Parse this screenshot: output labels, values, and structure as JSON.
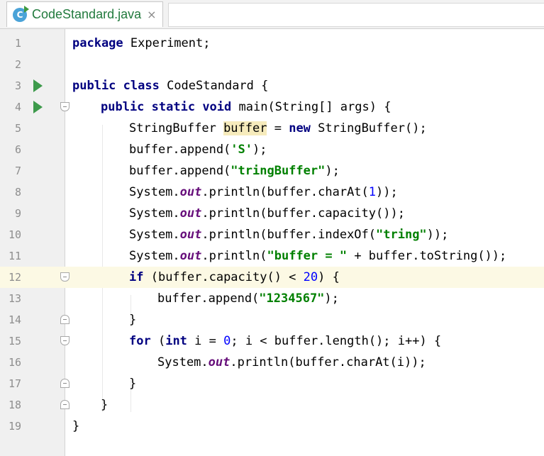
{
  "tab": {
    "title": "CodeStandard.java",
    "close": "×",
    "icon_letter": "C"
  },
  "lines": [
    {
      "n": "1"
    },
    {
      "n": "2"
    },
    {
      "n": "3"
    },
    {
      "n": "4"
    },
    {
      "n": "5"
    },
    {
      "n": "6"
    },
    {
      "n": "7"
    },
    {
      "n": "8"
    },
    {
      "n": "9"
    },
    {
      "n": "10"
    },
    {
      "n": "11"
    },
    {
      "n": "12"
    },
    {
      "n": "13"
    },
    {
      "n": "14"
    },
    {
      "n": "15"
    },
    {
      "n": "16"
    },
    {
      "n": "17"
    },
    {
      "n": "18"
    },
    {
      "n": "19"
    }
  ],
  "code": {
    "kw_package": "package",
    "pkg": " Experiment;",
    "kw_public": "public",
    "kw_class": " class",
    "cls": " CodeStandard {",
    "kw_public2": "public",
    "kw_static": " static",
    "kw_void": " void",
    "main_sig": " main(String[] args) {",
    "sb_type": "StringBuffer ",
    "sb_var": "buffer",
    "sb_eq": " = ",
    "kw_new": "new",
    "sb_ctor": " StringBuffer();",
    "l6_a": "buffer.append(",
    "l6_s": "'S'",
    "l6_b": ");",
    "l7_a": "buffer.append(",
    "l7_s": "\"tringBuffer\"",
    "l7_b": ");",
    "sys": "System.",
    "out": "out",
    "l8_a": ".println(buffer.charAt(",
    "l8_n": "1",
    "l8_b": "));",
    "l9_a": ".println(buffer.capacity());",
    "l10_a": ".println(buffer.indexOf(",
    "l10_s": "\"tring\"",
    "l10_b": "));",
    "l11_a": ".println(",
    "l11_s": "\"buffer = \"",
    "l11_b": " + buffer.toString());",
    "kw_if": "if",
    "l12_a": " (buffer.capacity() < ",
    "l12_n": "20",
    "l12_b": ") {",
    "l13_a": "buffer.append(",
    "l13_s": "\"1234567\"",
    "l13_b": ");",
    "brace": "}",
    "kw_for": "for",
    "l15_a": " (",
    "kw_int": "int",
    "l15_b": " i = ",
    "l15_n": "0",
    "l15_c": "; i < buffer.length(); i++) {",
    "l16_a": ".println(buffer.charAt(i));"
  },
  "colors": {
    "keyword": "#000080",
    "string": "#008000",
    "number": "#0000ff",
    "static_field": "#660e7a",
    "current_line": "#fcf9e4",
    "highlight": "#f6ebbc",
    "run_icon": "#3d9a4b"
  }
}
